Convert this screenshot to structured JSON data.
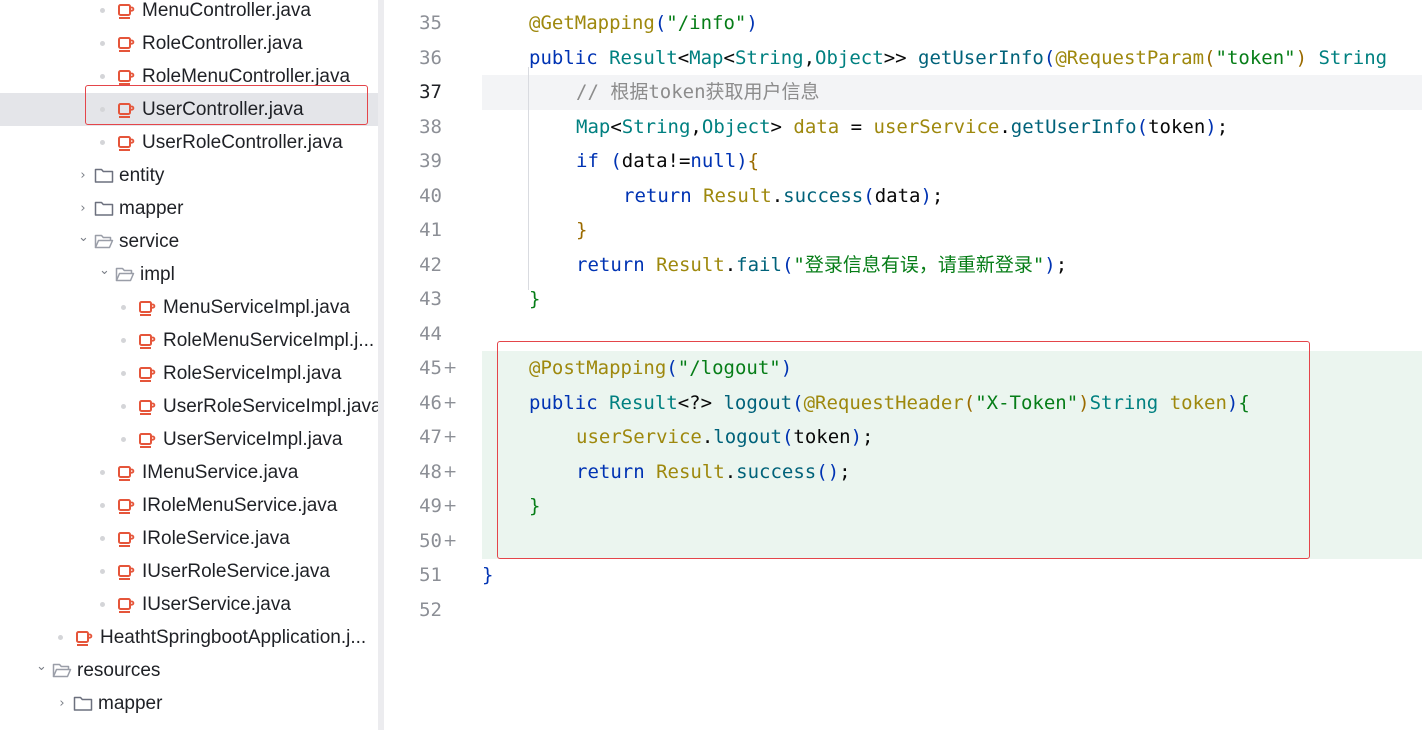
{
  "tree": {
    "items": [
      {
        "label": "MenuController.java",
        "kind": "java",
        "indent": 100,
        "selected": false
      },
      {
        "label": "RoleController.java",
        "kind": "java",
        "indent": 100,
        "selected": false
      },
      {
        "label": "RoleMenuController.java",
        "kind": "java",
        "indent": 100,
        "selected": false
      },
      {
        "label": "UserController.java",
        "kind": "java",
        "indent": 100,
        "selected": true
      },
      {
        "label": "UserRoleController.java",
        "kind": "java",
        "indent": 100,
        "selected": false
      },
      {
        "label": "entity",
        "kind": "folder-collapsed",
        "indent": 78,
        "selected": false
      },
      {
        "label": "mapper",
        "kind": "folder-collapsed",
        "indent": 78,
        "selected": false
      },
      {
        "label": "service",
        "kind": "folder-open",
        "indent": 78,
        "selected": false
      },
      {
        "label": "impl",
        "kind": "folder-open",
        "indent": 99,
        "selected": false
      },
      {
        "label": "MenuServiceImpl.java",
        "kind": "java",
        "indent": 121,
        "selected": false
      },
      {
        "label": "RoleMenuServiceImpl.j...",
        "kind": "java",
        "indent": 121,
        "selected": false
      },
      {
        "label": "RoleServiceImpl.java",
        "kind": "java",
        "indent": 121,
        "selected": false
      },
      {
        "label": "UserRoleServiceImpl.java",
        "kind": "java",
        "indent": 121,
        "selected": false
      },
      {
        "label": "UserServiceImpl.java",
        "kind": "java",
        "indent": 121,
        "selected": false
      },
      {
        "label": "IMenuService.java",
        "kind": "java",
        "indent": 100,
        "selected": false
      },
      {
        "label": "IRoleMenuService.java",
        "kind": "java",
        "indent": 100,
        "selected": false
      },
      {
        "label": "IRoleService.java",
        "kind": "java",
        "indent": 100,
        "selected": false
      },
      {
        "label": "IUserRoleService.java",
        "kind": "java",
        "indent": 100,
        "selected": false
      },
      {
        "label": "IUserService.java",
        "kind": "java",
        "indent": 100,
        "selected": false
      },
      {
        "label": "HeathtSpringbootApplication.j...",
        "kind": "java",
        "indent": 58,
        "selected": false
      },
      {
        "label": "resources",
        "kind": "folder-open",
        "indent": 36,
        "selected": false
      },
      {
        "label": "mapper",
        "kind": "folder-collapsed",
        "indent": 57,
        "selected": false
      }
    ]
  },
  "editor": {
    "current_line": 37,
    "lines": [
      {
        "n": "35",
        "added": false,
        "indent": 1,
        "tokens": [
          [
            "ann",
            "@"
          ],
          [
            "ann-name",
            "GetMapping"
          ],
          [
            "brk1",
            "("
          ],
          [
            "str",
            "\"/info\""
          ],
          [
            "brk1",
            ")"
          ]
        ]
      },
      {
        "n": "36",
        "added": false,
        "indent": 1,
        "tokens": [
          [
            "kw",
            "public "
          ],
          [
            "cls",
            "Result"
          ],
          [
            "",
            "<"
          ],
          [
            "cls",
            "Map"
          ],
          [
            "",
            "<"
          ],
          [
            "cls",
            "String"
          ],
          [
            "",
            ","
          ],
          [
            "cls",
            "Object"
          ],
          [
            "",
            ">> "
          ],
          [
            "fn",
            "getUserInfo"
          ],
          [
            "brk1",
            "("
          ],
          [
            "ann",
            "@"
          ],
          [
            "ann-name",
            "RequestParam"
          ],
          [
            "brk2",
            "("
          ],
          [
            "str",
            "\"token\""
          ],
          [
            "brk2",
            ")"
          ],
          [
            "cls",
            " String "
          ],
          [
            "",
            ""
          ]
        ]
      },
      {
        "n": "37",
        "added": false,
        "indent": 2,
        "tokens": [
          [
            "cmt",
            "// 根据token获取用户信息"
          ]
        ]
      },
      {
        "n": "38",
        "added": false,
        "indent": 2,
        "tokens": [
          [
            "cls",
            "Map"
          ],
          [
            "",
            "<"
          ],
          [
            "cls",
            "String"
          ],
          [
            "",
            ","
          ],
          [
            "cls",
            "Object"
          ],
          [
            "",
            "> "
          ],
          [
            "ann",
            "data"
          ],
          [
            "",
            " = "
          ],
          [
            "ann",
            "userService"
          ],
          [
            "",
            "."
          ],
          [
            "fn",
            "getUserInfo"
          ],
          [
            "brk1",
            "("
          ],
          [
            "",
            "token"
          ],
          [
            "brk1",
            ")"
          ],
          [
            "",
            ";"
          ]
        ]
      },
      {
        "n": "39",
        "added": false,
        "indent": 2,
        "tokens": [
          [
            "kw",
            "if "
          ],
          [
            "brk1",
            "("
          ],
          [
            "",
            "data!="
          ],
          [
            "kw",
            "null"
          ],
          [
            "brk1",
            ")"
          ],
          [
            "brk2",
            "{"
          ]
        ]
      },
      {
        "n": "40",
        "added": false,
        "indent": 3,
        "tokens": [
          [
            "kw",
            "return "
          ],
          [
            "ann",
            "Result"
          ],
          [
            "",
            "."
          ],
          [
            "fn",
            "success"
          ],
          [
            "brk1",
            "("
          ],
          [
            "",
            "data"
          ],
          [
            "brk1",
            ")"
          ],
          [
            "",
            ";"
          ]
        ]
      },
      {
        "n": "41",
        "added": false,
        "indent": 2,
        "tokens": [
          [
            "brk2",
            "}"
          ]
        ]
      },
      {
        "n": "42",
        "added": false,
        "indent": 2,
        "tokens": [
          [
            "kw",
            "return "
          ],
          [
            "ann",
            "Result"
          ],
          [
            "",
            "."
          ],
          [
            "fn",
            "fail"
          ],
          [
            "brk1",
            "("
          ],
          [
            "str",
            "\"登录信息有误，请重新登录\""
          ],
          [
            "brk1",
            ")"
          ],
          [
            "",
            ";"
          ]
        ]
      },
      {
        "n": "43",
        "added": false,
        "indent": 1,
        "tokens": [
          [
            "brk3",
            "}"
          ]
        ]
      },
      {
        "n": "44",
        "added": false,
        "indent": 0,
        "tokens": []
      },
      {
        "n": "45",
        "added": true,
        "indent": 1,
        "tokens": [
          [
            "ann",
            "@"
          ],
          [
            "ann-name",
            "PostMapping"
          ],
          [
            "brk1",
            "("
          ],
          [
            "str",
            "\"/logout\""
          ],
          [
            "brk1",
            ")"
          ]
        ]
      },
      {
        "n": "46",
        "added": true,
        "indent": 1,
        "tokens": [
          [
            "kw",
            "public "
          ],
          [
            "cls",
            "Result"
          ],
          [
            "",
            "<?> "
          ],
          [
            "fn",
            "logout"
          ],
          [
            "brk1",
            "("
          ],
          [
            "ann",
            "@"
          ],
          [
            "ann-name",
            "RequestHeader"
          ],
          [
            "brk2",
            "("
          ],
          [
            "str",
            "\"X-Token\""
          ],
          [
            "brk2",
            ")"
          ],
          [
            "cls",
            "String "
          ],
          [
            "ann",
            "token"
          ],
          [
            "brk1",
            ")"
          ],
          [
            "brk3",
            "{"
          ]
        ]
      },
      {
        "n": "47",
        "added": true,
        "indent": 2,
        "tokens": [
          [
            "ann",
            "userService"
          ],
          [
            "",
            "."
          ],
          [
            "fn",
            "logout"
          ],
          [
            "brk1",
            "("
          ],
          [
            "",
            "token"
          ],
          [
            "brk1",
            ")"
          ],
          [
            "",
            ";"
          ]
        ]
      },
      {
        "n": "48",
        "added": true,
        "indent": 2,
        "tokens": [
          [
            "kw",
            "return "
          ],
          [
            "ann",
            "Result"
          ],
          [
            "",
            "."
          ],
          [
            "fn",
            "success"
          ],
          [
            "brk1",
            "("
          ],
          [
            "brk1",
            ")"
          ],
          [
            "",
            ";"
          ]
        ]
      },
      {
        "n": "49",
        "added": true,
        "indent": 1,
        "tokens": [
          [
            "brk3",
            "}"
          ]
        ]
      },
      {
        "n": "50",
        "added": true,
        "indent": 0,
        "tokens": []
      },
      {
        "n": "51",
        "added": false,
        "indent": 0,
        "tokens": [
          [
            "brk1",
            "}"
          ]
        ]
      },
      {
        "n": "52",
        "added": false,
        "indent": 0,
        "tokens": []
      }
    ],
    "diff_marker": "+"
  }
}
